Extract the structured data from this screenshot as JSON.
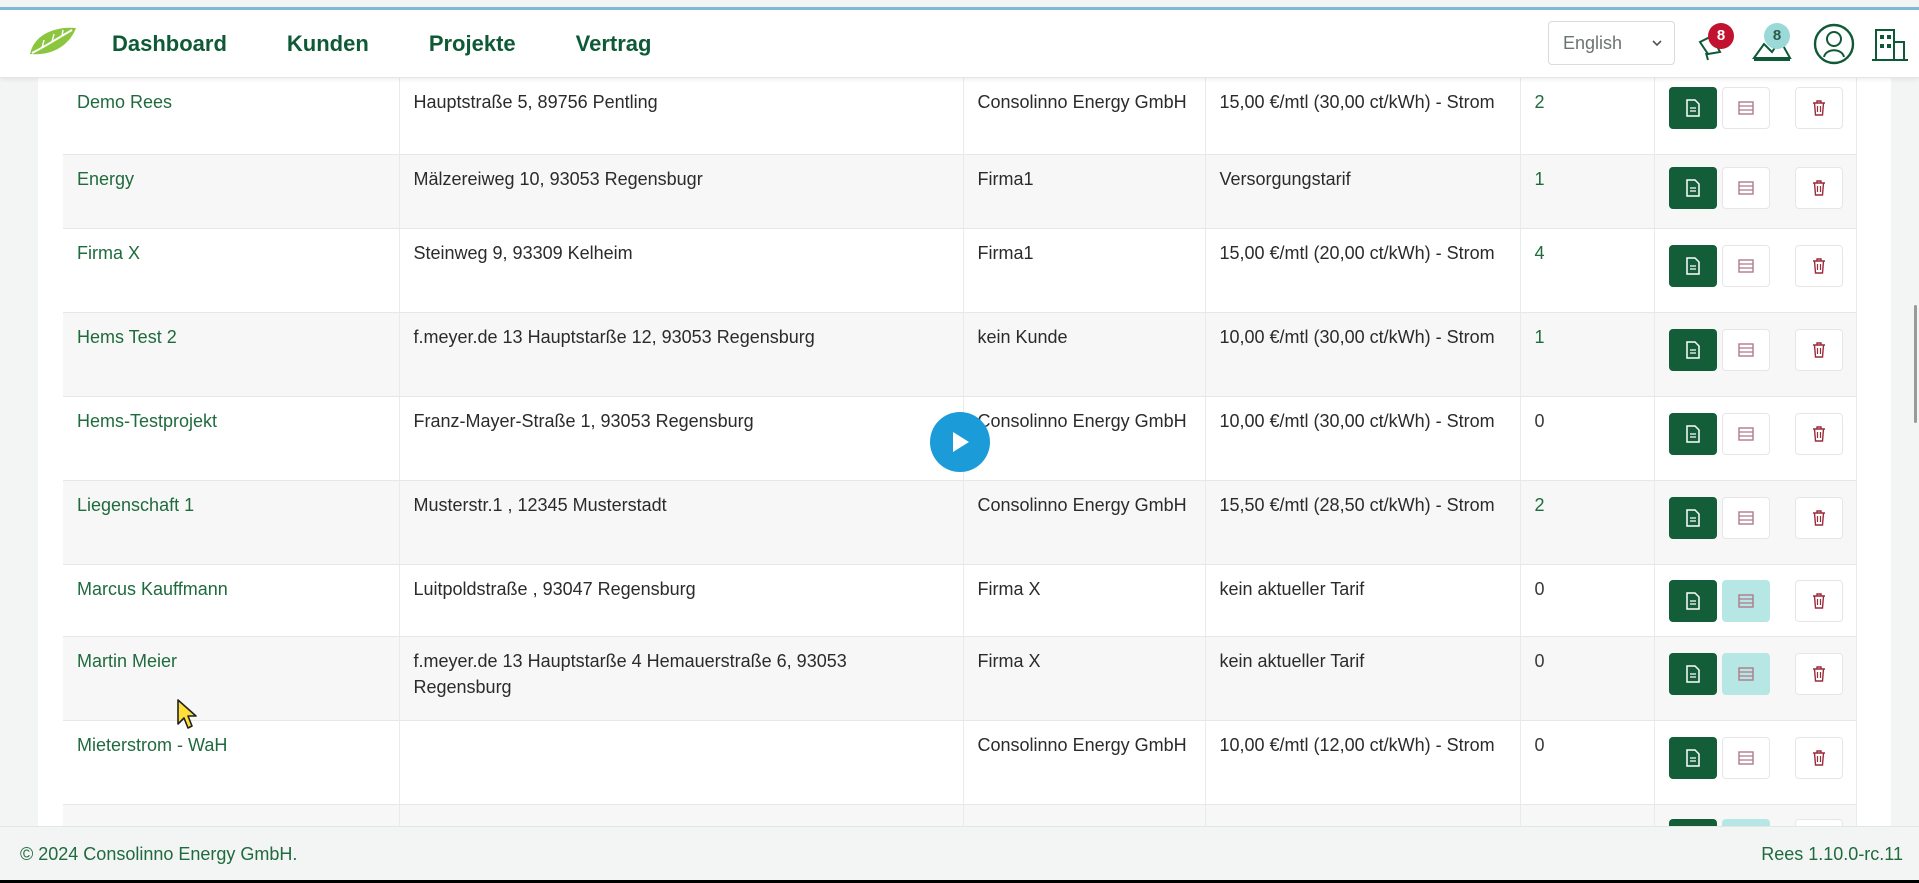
{
  "nav": {
    "logo": "leaf-logo",
    "links": [
      "Dashboard",
      "Kunden",
      "Projekte",
      "Vertrag"
    ],
    "language": "English",
    "notifications_count": "8",
    "tasks_count": "8"
  },
  "table": {
    "rows": [
      {
        "name": "Demo Rees",
        "address": "Hauptstraße 5, 89756 Pentling",
        "customer": "Consolinno Energy GmbH",
        "tariff": "15,00 €/mtl (30,00 ct/kWh) - Strom",
        "count": "2"
      },
      {
        "name": "Energy",
        "address": "Mälzereiweg 10, 93053 Regensbugr",
        "customer": "Firma1",
        "tariff": "Versorgungstarif",
        "count": "1"
      },
      {
        "name": "Firma X",
        "address": "Steinweg 9, 93309 Kelheim",
        "customer": "Firma1",
        "tariff": "15,00 €/mtl (20,00 ct/kWh) - Strom",
        "count": "4"
      },
      {
        "name": "Hems Test 2",
        "address": "f.meyer.de 13 Hauptstarße 12, 93053 Regensburg",
        "customer": "kein Kunde",
        "tariff": "10,00 €/mtl (30,00 ct/kWh) - Strom",
        "count": "1"
      },
      {
        "name": "Hems-Testprojekt",
        "address": "Franz-Mayer-Straße 1, 93053 Regensburg",
        "customer": "Consolinno Energy GmbH",
        "tariff": "10,00 €/mtl (30,00 ct/kWh) - Strom",
        "count": "0"
      },
      {
        "name": "Liegenschaft 1",
        "address": "Musterstr.1 , 12345 Musterstadt",
        "customer": "Consolinno Energy GmbH",
        "tariff": "15,50 €/mtl (28,50 ct/kWh) - Strom",
        "count": "2"
      },
      {
        "name": "Marcus Kauffmann",
        "address": "Luitpoldstraße , 93047 Regensburg",
        "customer": "Firma X",
        "tariff": "kein aktueller Tarif",
        "count": "0"
      },
      {
        "name": "Martin Meier",
        "address": "f.meyer.de 13 Hauptstarße 4 Hemauerstraße 6, 93053 Regensburg",
        "customer": "Firma X",
        "tariff": "kein aktueller Tarif",
        "count": "0"
      },
      {
        "name": "Mieterstrom - WaH",
        "address": "",
        "customer": "Consolinno Energy GmbH",
        "tariff": "10,00 €/mtl (12,00 ct/kWh) - Strom",
        "count": "0"
      },
      {
        "name": "",
        "address": "",
        "customer": "",
        "tariff": "",
        "count": ""
      }
    ]
  },
  "footer": {
    "copyright": "© 2024 Consolinno Energy GmbH.",
    "version": "Rees 1.10.0-rc.11"
  },
  "colors": {
    "primary_green": "#135e38",
    "link_green": "#1f6b3d",
    "badge_red": "#c1122f",
    "active_list_button": "#b6e7e4",
    "play_button": "#1b9bd8"
  }
}
